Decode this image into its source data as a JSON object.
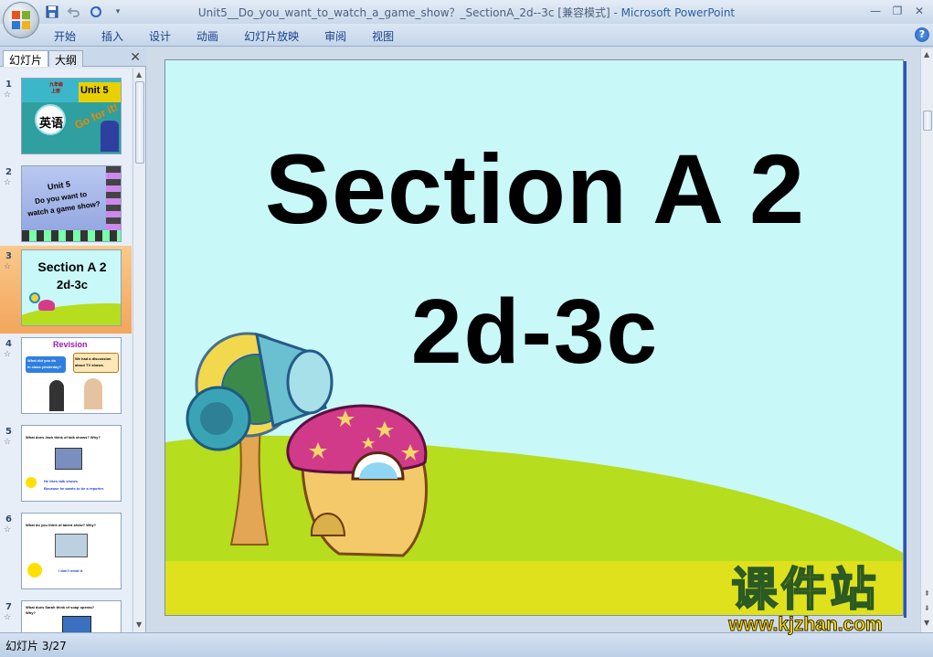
{
  "window": {
    "title_doc": "Unit5__Do_you_want_to_watch_a_game_show？_SectionA_2d--3c [兼容模式]",
    "title_sep": " - ",
    "title_app": "Microsoft PowerPoint"
  },
  "qat": {
    "save": "save-icon",
    "undo": "undo-icon",
    "redo": "redo-icon",
    "customize": "▾"
  },
  "ribbon": {
    "tabs": [
      "开始",
      "插入",
      "设计",
      "动画",
      "幻灯片放映",
      "审阅",
      "视图"
    ],
    "help": "?"
  },
  "left_pane": {
    "tabs": [
      "幻灯片",
      "大纲"
    ],
    "close": "✕",
    "slides": [
      {
        "number": "1",
        "texts": [
          "英语",
          "Unit 5",
          "九年级",
          "上册",
          "Go for it!"
        ]
      },
      {
        "number": "2",
        "texts": [
          "Unit 5",
          "Do you want to",
          "watch a game show?"
        ]
      },
      {
        "number": "3",
        "texts": [
          "Section A 2",
          "2d-3c"
        ]
      },
      {
        "number": "4",
        "texts": [
          "Revision",
          "What did you do",
          "in class yesterday?",
          "We had a discussion",
          "about TV shows."
        ]
      },
      {
        "number": "5",
        "texts": [
          "What does Jack think of talk shows? Why?",
          "He likes talk shows.",
          "Because he wants to be a reporter."
        ]
      },
      {
        "number": "6",
        "texts": [
          "What do you think of talent show? Why?",
          "I don't mind it."
        ]
      },
      {
        "number": "7",
        "texts": [
          "What does Sarah think of soap operas?",
          "Why?"
        ]
      }
    ],
    "selected_index": 2
  },
  "slide": {
    "title_line1": "Section A 2",
    "title_line2": "2d-3c"
  },
  "status": {
    "slide_label": "幻灯片 3/27"
  },
  "watermark": {
    "cn": "课件站",
    "url": "www.kjzhan.com"
  },
  "colors": {
    "slide_bg": "#c9f8f9",
    "grass": "#b6dd1e",
    "ribbon_text": "#15428b",
    "selected_thumb": "#f3a55b"
  }
}
